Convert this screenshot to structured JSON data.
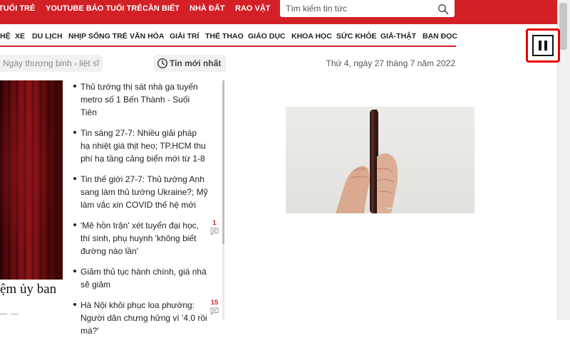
{
  "top_nav": {
    "links": [
      "TUỔI TRẺ",
      "YOUTUBE BÁO TUỔI TRẺ",
      "CẦN BIẾT",
      "NHÀ ĐẤT",
      "RAO VẶT"
    ],
    "search_placeholder": "Tìm kiếm tin tức",
    "search_icon": "search-icon"
  },
  "main_nav": {
    "items": [
      "HỆ",
      "XE",
      "DU LỊCH",
      "NHỊP SỐNG TRẺ",
      "VĂN HÓA",
      "GIẢI TRÍ",
      "THỂ THAO",
      "GIÁO DỤC",
      "KHOA HỌC",
      "SỨC KHỎE",
      "GIẢ-THẬT",
      "BẠN ĐỌC"
    ]
  },
  "toolbar": {
    "tag": "Ngày thương binh - liệt sĩ",
    "latest_label": "Tin mới nhất",
    "latest_icon": "clock-icon",
    "date": "Thứ 4, ngày 27 tháng 7 năm 2022"
  },
  "hero": {
    "title_fragment": "ệm ủy ban"
  },
  "news": [
    {
      "text": "Thủ tướng thị sát nhà ga tuyến metro số 1 Bến Thành - Suối Tiên",
      "comments": ""
    },
    {
      "text": "Tin sáng 27-7: Nhiều giải pháp hạ nhiệt giá thịt heo; TP.HCM thu phí hạ tầng cảng biển mới từ 1-8",
      "comments": ""
    },
    {
      "text": "Tin thế giới 27-7: Thủ tướng Anh sang làm thủ tướng Ukraine?; Mỹ làm vắc xin COVID thế hệ mới",
      "comments": ""
    },
    {
      "text": "'Mê hồn trận' xét tuyển đại học, thí sinh, phụ huynh 'không biết đường nào lần'",
      "comments": "1"
    },
    {
      "text": "Giảm thủ tục hành chính, giá nhà sẽ giảm",
      "comments": ""
    },
    {
      "text": "Hà Nội khôi phục loa phường: Người dân chưng hửng vì '4.0 rồi mà?'",
      "comments": "15"
    }
  ],
  "video": {
    "pause_icon": "pause-icon",
    "highlight_color": "#e60000"
  },
  "colors": {
    "brand_red": "#d32026",
    "comment_red": "#d32026"
  }
}
